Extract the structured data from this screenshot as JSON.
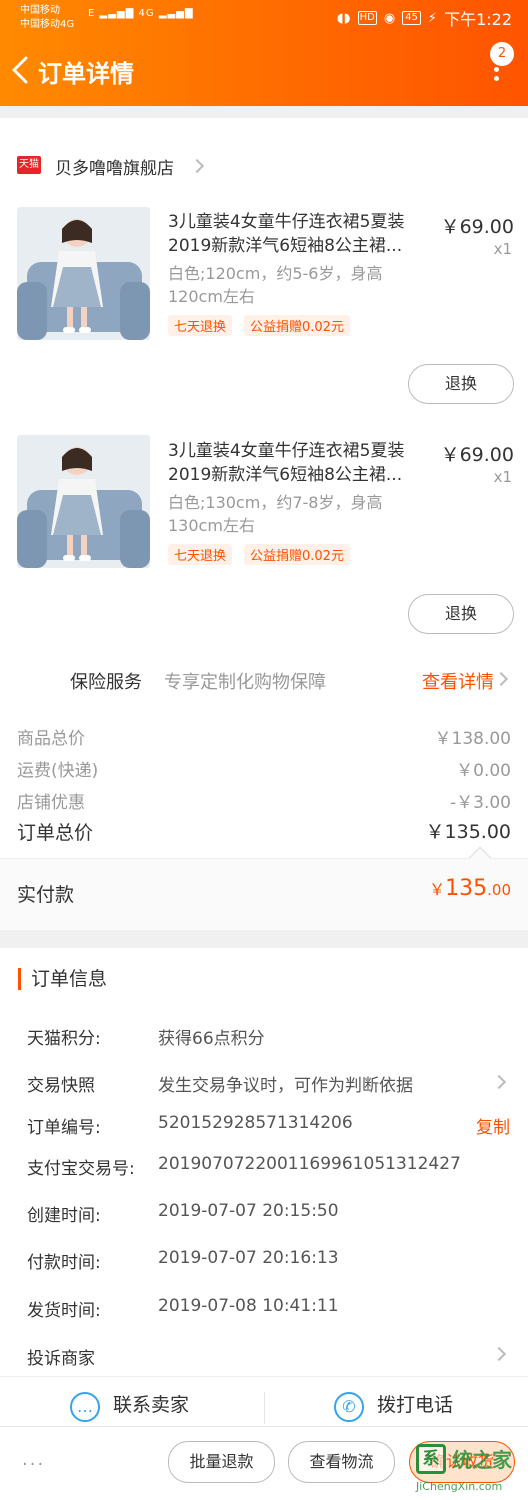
{
  "status_bar": {
    "carrier1": "中国移动",
    "carrier2": "中国移动4G",
    "signal": "E",
    "signal2": "4G",
    "hd": "HD",
    "battery": "45",
    "time": "下午1:22"
  },
  "header": {
    "title": "订单详情",
    "badge_count": "2"
  },
  "shop": {
    "badge": "天猫",
    "name": "贝多噜噜旗舰店"
  },
  "products": [
    {
      "title": "3儿童装4女童牛仔连衣裙5夏装2019新款洋气6短袖8公主裙...",
      "price": "￥69.00",
      "qty": "x1",
      "spec1": "白色;120cm，约5-6岁，身高",
      "spec2": "120cm左右",
      "tag1": "七天退换",
      "tag2": "公益捐赠0.02元",
      "refund_label": "退换"
    },
    {
      "title": "3儿童装4女童牛仔连衣裙5夏装2019新款洋气6短袖8公主裙...",
      "price": "￥69.00",
      "qty": "x1",
      "spec1": "白色;130cm，约7-8岁，身高",
      "spec2": "130cm左右",
      "tag1": "七天退换",
      "tag2": "公益捐赠0.02元",
      "refund_label": "退换"
    }
  ],
  "insurance": {
    "label": "保险服务",
    "desc": "专享定制化购物保障",
    "link": "查看详情"
  },
  "summary": {
    "goods_label": "商品总价",
    "goods_val": "￥138.00",
    "ship_label": "运费(快递)",
    "ship_val": "￥0.00",
    "discount_label": "店铺优惠",
    "discount_val": "-￥3.00",
    "total_label": "订单总价",
    "total_val": "￥135.00",
    "paid_label": "实付款",
    "paid_currency": "￥",
    "paid_int": "135",
    "paid_dec": ".00"
  },
  "order_info": {
    "heading": "订单信息",
    "points_label": "天猫积分:",
    "points_val": "获得66点积分",
    "snapshot_label": "交易快照",
    "snapshot_val": "发生交易争议时，可作为判断依据",
    "order_no_label": "订单编号:",
    "order_no_val": "520152928571314206",
    "copy_label": "复制",
    "alipay_label": "支付宝交易号:",
    "alipay_val": "2019070722001169961051312427",
    "created_label": "创建时间:",
    "created_val": "2019-07-07 20:15:50",
    "paid_time_label": "付款时间:",
    "paid_time_val": "2019-07-07 20:16:13",
    "ship_time_label": "发货时间:",
    "ship_time_val": "2019-07-08 10:41:11",
    "complaint_label": "投诉商家"
  },
  "contact": {
    "seller_label": "联系卖家",
    "phone_label": "拨打电话"
  },
  "bottom": {
    "more": "···",
    "batch_refund": "批量退款",
    "logistics": "查看物流",
    "confirm": "确认收货"
  },
  "watermark": {
    "mark": "系",
    "text": "统之家",
    "url": "JiChengXin.com"
  },
  "colors": {
    "accent": "#ff5000",
    "header_start": "#ff8a00",
    "header_end": "#ff5400",
    "contact_icon": "#35a4e8"
  }
}
